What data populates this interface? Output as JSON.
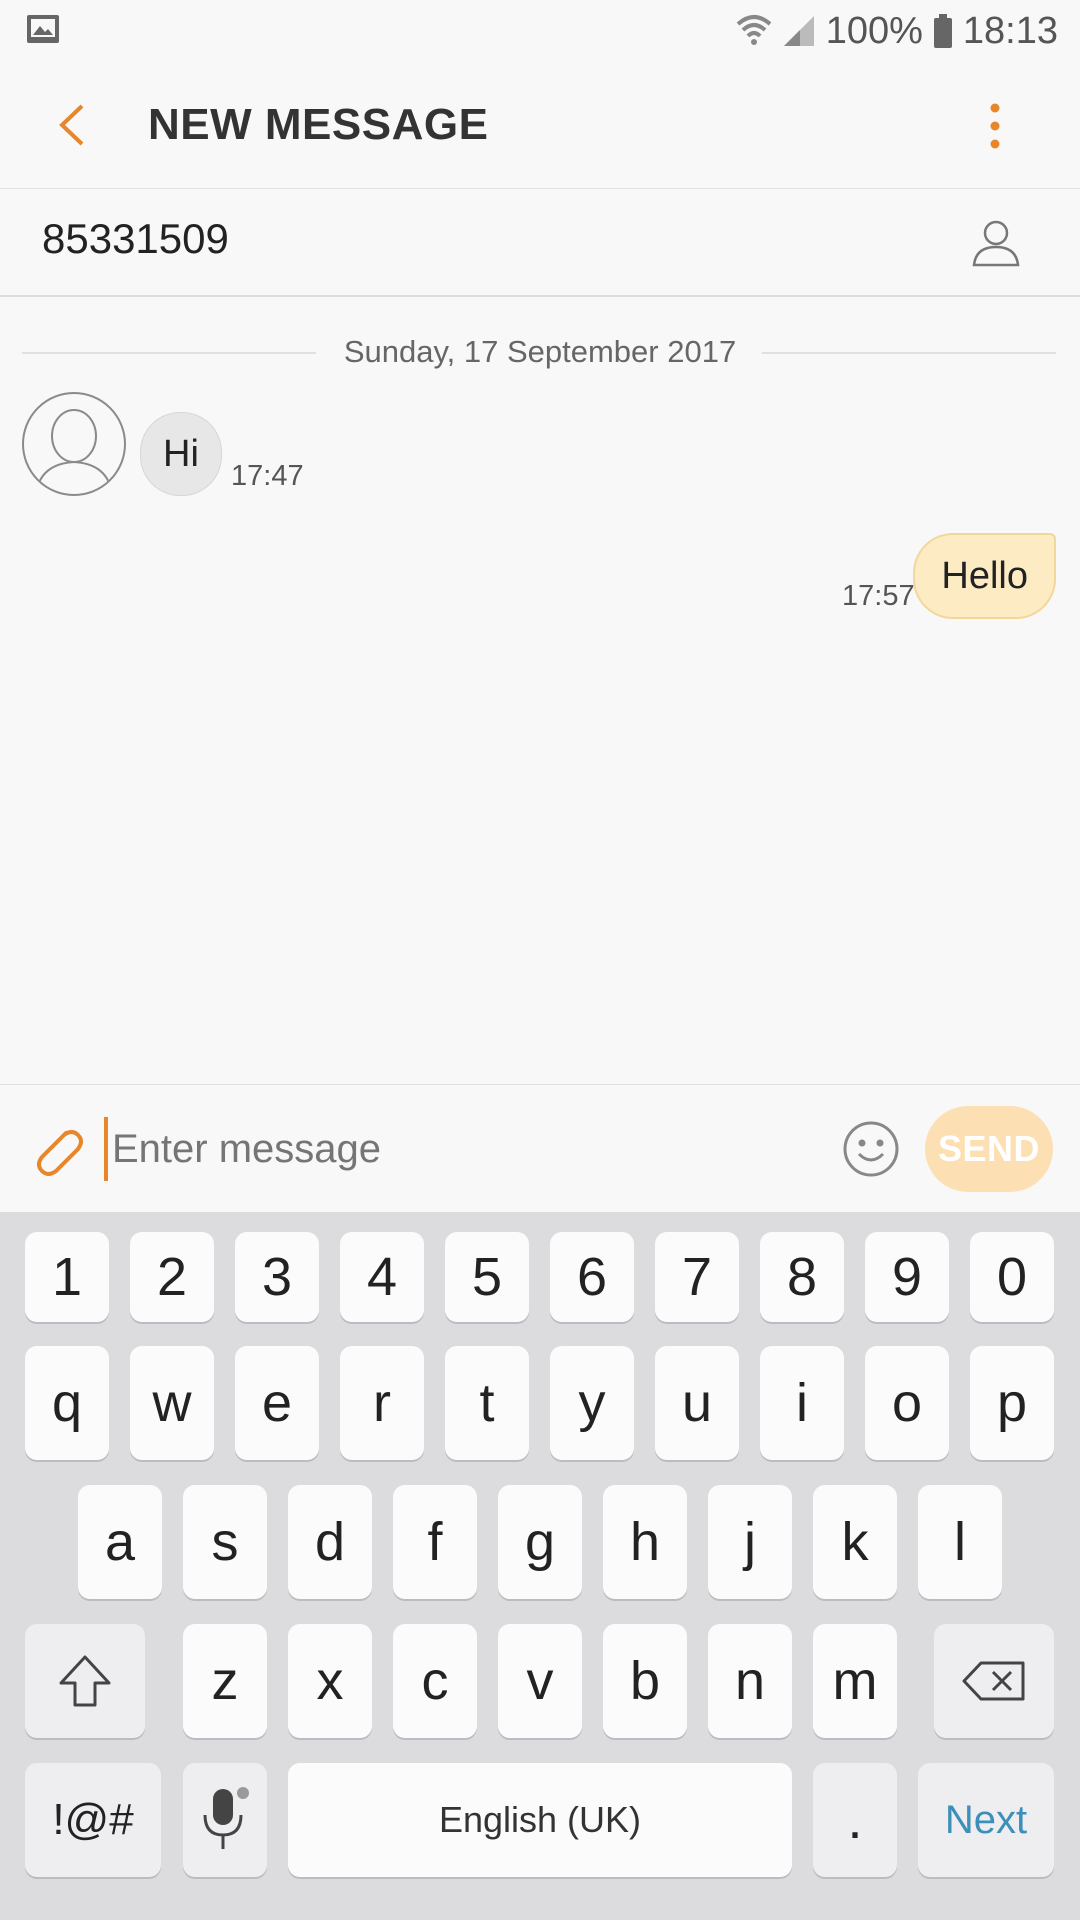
{
  "status": {
    "battery": "100%",
    "time": "18:13"
  },
  "header": {
    "title": "NEW MESSAGE"
  },
  "recipient": {
    "number": "85331509"
  },
  "conversation": {
    "date": "Sunday, 17 September 2017",
    "messages": [
      {
        "direction": "incoming",
        "text": "Hi",
        "time": "17:47"
      },
      {
        "direction": "outgoing",
        "text": "Hello",
        "time": "17:57"
      }
    ]
  },
  "composer": {
    "placeholder": "Enter message",
    "send_label": "SEND"
  },
  "keyboard": {
    "row_numbers": [
      "1",
      "2",
      "3",
      "4",
      "5",
      "6",
      "7",
      "8",
      "9",
      "0"
    ],
    "row1": [
      "q",
      "w",
      "e",
      "r",
      "t",
      "y",
      "u",
      "i",
      "o",
      "p"
    ],
    "row2": [
      "a",
      "s",
      "d",
      "f",
      "g",
      "h",
      "j",
      "k",
      "l"
    ],
    "row3": [
      "z",
      "x",
      "c",
      "v",
      "b",
      "n",
      "m"
    ],
    "symbols_label": "!@#",
    "space_label": "English (UK)",
    "period_label": ".",
    "next_label": "Next"
  },
  "colors": {
    "accent": "#e8862a",
    "outgoing_bubble": "#fdebc4",
    "next": "#3c8fb8"
  },
  "icons": [
    "gallery-icon",
    "wifi-icon",
    "signal-icon",
    "battery-icon",
    "back-icon",
    "more-icon",
    "contact-icon",
    "attach-icon",
    "emoji-icon",
    "shift-icon",
    "backspace-icon",
    "mic-icon"
  ]
}
